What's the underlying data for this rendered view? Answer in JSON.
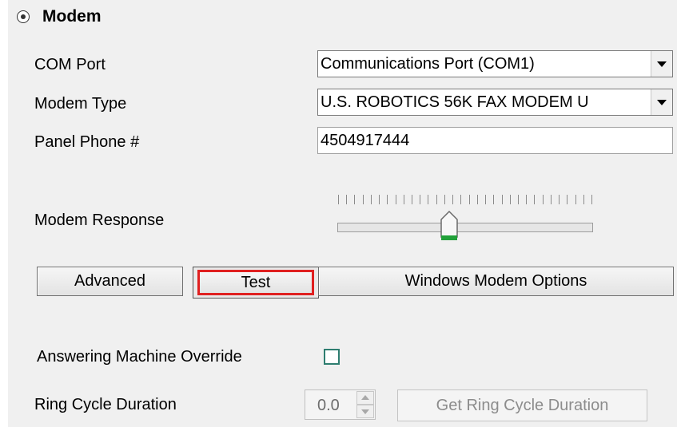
{
  "section": {
    "title": "Modem",
    "radio_selected": true
  },
  "fields": {
    "com_port": {
      "label": "COM Port",
      "value": "Communications Port (COM1)"
    },
    "modem_type": {
      "label": "Modem Type",
      "value": "U.S. ROBOTICS 56K FAX MODEM U"
    },
    "panel_phone": {
      "label": "Panel Phone #",
      "value": "4504917444"
    }
  },
  "modem_response": {
    "label": "Modem Response",
    "tick_count": 32,
    "thumb_position_fraction": 0.47
  },
  "buttons": {
    "advanced": "Advanced",
    "test": "Test",
    "windows_modem_options": "Windows Modem Options",
    "get_ring_cycle_duration": "Get Ring Cycle Duration"
  },
  "answering_machine_override": {
    "label": "Answering Machine Override",
    "checked": false
  },
  "ring_cycle_duration": {
    "label": "Ring Cycle Duration",
    "value": "0.0"
  },
  "colors": {
    "highlight_border": "#e02020",
    "checkbox_border": "#2e7d70",
    "slider_thumb_accent": "#22a13a"
  }
}
